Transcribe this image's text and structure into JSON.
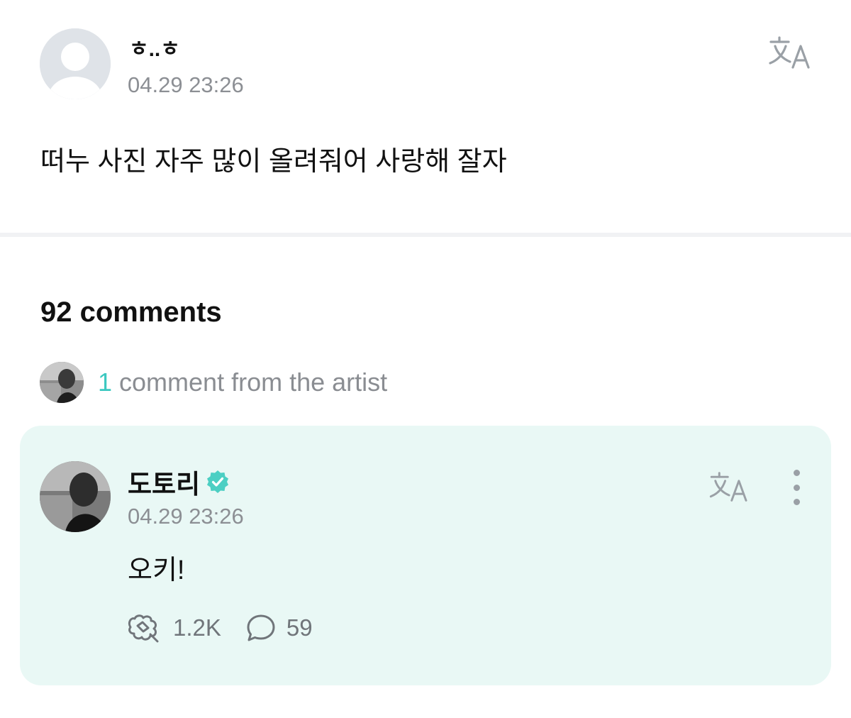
{
  "post": {
    "author_name": "ㅎ..ㅎ",
    "timestamp": "04.29 23:26",
    "body": "떠누 사진 자주 많이 올려줘어 사랑해 잘자",
    "translate_icon": "translate-icon",
    "avatar_icon": "default-avatar-icon"
  },
  "comments": {
    "count_label": "92 comments",
    "artist_summary": {
      "count": "1",
      "label": " comment from the artist"
    }
  },
  "artist_comment": {
    "author_name": "도토리",
    "verified_icon": "verified-badge-icon",
    "timestamp": "04.29 23:26",
    "body": "오키!",
    "likes": "1.2K",
    "replies": "59",
    "like_icon": "like-icon",
    "reply_icon": "speech-bubble-icon",
    "more_icon": "more-vertical-icon"
  },
  "colors": {
    "accent": "#3cc8c0",
    "card_background": "#e9f8f5",
    "secondary_text": "#8c8f94"
  }
}
